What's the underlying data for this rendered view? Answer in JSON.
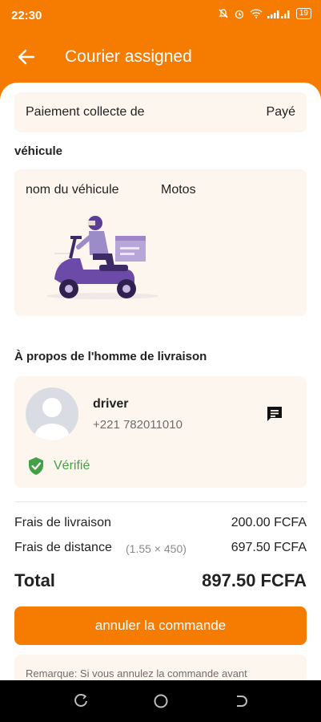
{
  "status_bar": {
    "time": "22:30",
    "battery": "19"
  },
  "header": {
    "title": "Courier assigned"
  },
  "payment": {
    "label": "Paiement collecte de",
    "value": "Payé"
  },
  "vehicle": {
    "section_title": "véhicule",
    "name_label": "nom du véhicule",
    "name_value": "Motos"
  },
  "driver": {
    "section_title": "À propos de l'homme de livraison",
    "name": "driver",
    "phone": "+221 782011010",
    "verified_label": "Vérifié"
  },
  "fees": {
    "delivery_label": "Frais de livraison",
    "delivery_value": "200.00 FCFA",
    "distance_label": "Frais de distance",
    "distance_detail": "(1.55 × 450)",
    "distance_value": "697.50 FCFA",
    "total_label": "Total",
    "total_value": "897.50 FCFA"
  },
  "cancel_button": "annuler la commande",
  "remark": "Remarque: Si vous annulez la commande avant",
  "colors": {
    "accent": "#f57c00",
    "card_bg": "#fdf6ee",
    "verified": "#43a047"
  }
}
